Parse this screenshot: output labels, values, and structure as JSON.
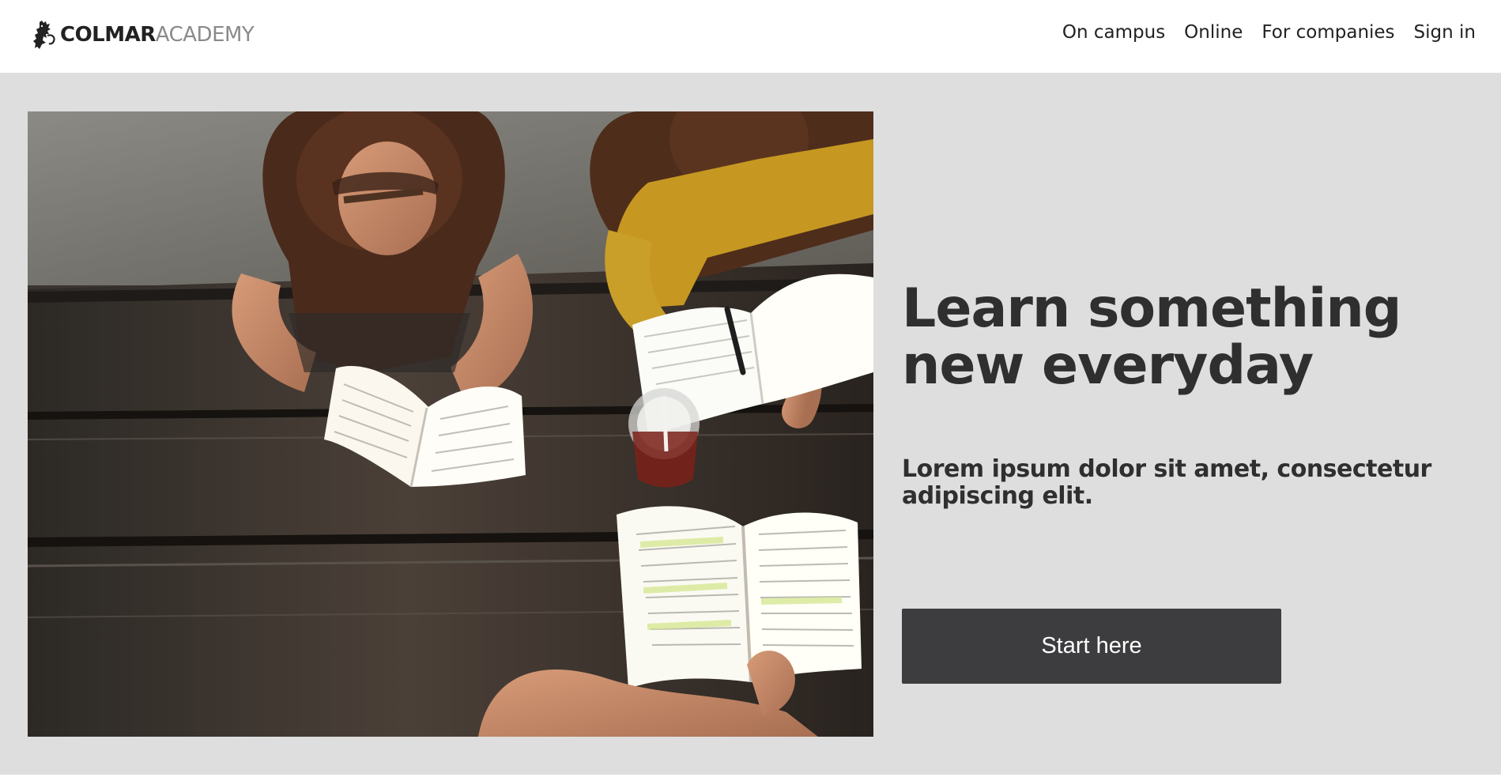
{
  "brand": {
    "name_bold": "COLMAR",
    "name_light": "ACADEMY",
    "logo_icon": "lion-rampant-icon"
  },
  "nav": {
    "items": [
      {
        "label": "On campus"
      },
      {
        "label": "Online"
      },
      {
        "label": "For companies"
      },
      {
        "label": "Sign in"
      }
    ]
  },
  "hero": {
    "title": "Learn something new everyday",
    "subtitle": "Lorem ipsum dolor sit amet, consectetur adipiscing elit.",
    "cta_label": "Start here",
    "image_subject": "students-reading-at-table"
  },
  "colors": {
    "hero_background": "#dedede",
    "button_background": "#3d3d3f",
    "button_text": "#ffffff",
    "text": "#2f2f2f",
    "logo_light": "#8a8a8a"
  }
}
